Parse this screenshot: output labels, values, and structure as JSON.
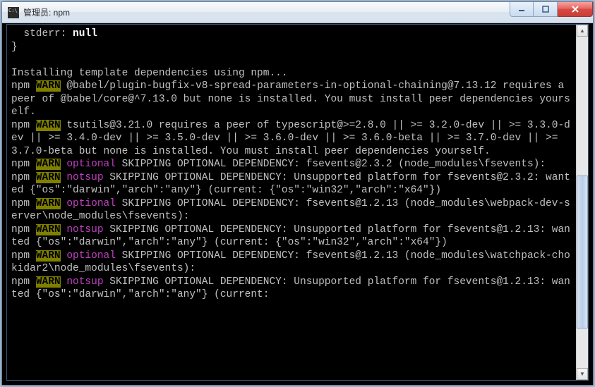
{
  "window": {
    "title": "管理员: npm"
  },
  "terminal": {
    "lines": [
      {
        "segs": [
          {
            "cls": "w",
            "t": "  stderr: "
          },
          {
            "cls": "bold",
            "t": "null"
          }
        ]
      },
      {
        "segs": [
          {
            "cls": "w",
            "t": "}"
          }
        ]
      },
      {
        "segs": [
          {
            "cls": "w",
            "t": ""
          }
        ]
      },
      {
        "segs": [
          {
            "cls": "w",
            "t": "Installing template dependencies using npm..."
          }
        ]
      },
      {
        "segs": [
          {
            "cls": "w",
            "t": "npm "
          },
          {
            "cls": "warn",
            "t": "WARN"
          },
          {
            "cls": "w",
            "t": " @babel/plugin-bugfix-v8-spread-parameters-in-optional-chaining@7.13.12 requires a peer of @babel/core@^7.13.0 but none is installed. You must install peer dependencies yourself."
          }
        ]
      },
      {
        "segs": [
          {
            "cls": "w",
            "t": "npm "
          },
          {
            "cls": "warn",
            "t": "WARN"
          },
          {
            "cls": "w",
            "t": " tsutils@3.21.0 requires a peer of typescript@>=2.8.0 || >= 3.2.0-dev || >= 3.3.0-dev || >= 3.4.0-dev || >= 3.5.0-dev || >= 3.6.0-dev || >= 3.6.0-beta || >= 3.7.0-dev || >= 3.7.0-beta but none is installed. You must install peer dependencies yourself."
          }
        ]
      },
      {
        "segs": [
          {
            "cls": "w",
            "t": "npm "
          },
          {
            "cls": "warn",
            "t": "WARN"
          },
          {
            "cls": "w",
            "t": " "
          },
          {
            "cls": "mag",
            "t": "optional"
          },
          {
            "cls": "w",
            "t": " SKIPPING OPTIONAL DEPENDENCY: fsevents@2.3.2 (node_modules\\fsevents):"
          }
        ]
      },
      {
        "segs": [
          {
            "cls": "w",
            "t": "npm "
          },
          {
            "cls": "warn",
            "t": "WARN"
          },
          {
            "cls": "w",
            "t": " "
          },
          {
            "cls": "mag",
            "t": "notsup"
          },
          {
            "cls": "w",
            "t": " SKIPPING OPTIONAL DEPENDENCY: Unsupported platform for fsevents@2.3.2: wanted {\"os\":\"darwin\",\"arch\":\"any\"} (current: {\"os\":\"win32\",\"arch\":\"x64\"})"
          }
        ]
      },
      {
        "segs": [
          {
            "cls": "w",
            "t": "npm "
          },
          {
            "cls": "warn",
            "t": "WARN"
          },
          {
            "cls": "w",
            "t": " "
          },
          {
            "cls": "mag",
            "t": "optional"
          },
          {
            "cls": "w",
            "t": " SKIPPING OPTIONAL DEPENDENCY: fsevents@1.2.13 (node_modules\\webpack-dev-server\\node_modules\\fsevents):"
          }
        ]
      },
      {
        "segs": [
          {
            "cls": "w",
            "t": "npm "
          },
          {
            "cls": "warn",
            "t": "WARN"
          },
          {
            "cls": "w",
            "t": " "
          },
          {
            "cls": "mag",
            "t": "notsup"
          },
          {
            "cls": "w",
            "t": " SKIPPING OPTIONAL DEPENDENCY: Unsupported platform for fsevents@1.2.13: wanted {\"os\":\"darwin\",\"arch\":\"any\"} (current: {\"os\":\"win32\",\"arch\":\"x64\"})"
          }
        ]
      },
      {
        "segs": [
          {
            "cls": "w",
            "t": "npm "
          },
          {
            "cls": "warn",
            "t": "WARN"
          },
          {
            "cls": "w",
            "t": " "
          },
          {
            "cls": "mag",
            "t": "optional"
          },
          {
            "cls": "w",
            "t": " SKIPPING OPTIONAL DEPENDENCY: fsevents@1.2.13 (node_modules\\watchpack-chokidar2\\node_modules\\fsevents):"
          }
        ]
      },
      {
        "segs": [
          {
            "cls": "w",
            "t": "npm "
          },
          {
            "cls": "warn",
            "t": "WARN"
          },
          {
            "cls": "w",
            "t": " "
          },
          {
            "cls": "mag",
            "t": "notsup"
          },
          {
            "cls": "w",
            "t": " SKIPPING OPTIONAL DEPENDENCY: Unsupported platform for fsevents@1.2.13: wanted {\"os\":\"darwin\",\"arch\":\"any\"} (current:"
          }
        ]
      }
    ]
  }
}
